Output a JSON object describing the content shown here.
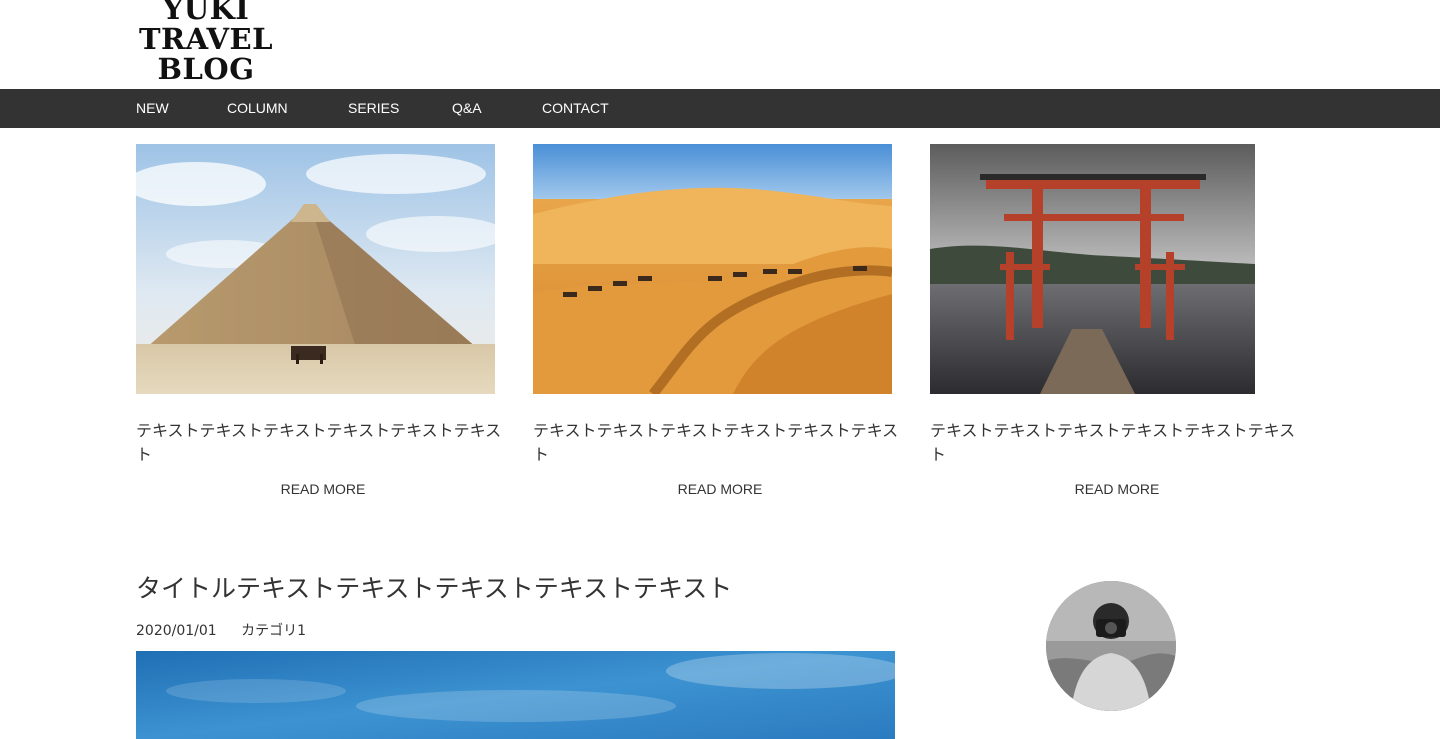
{
  "header": {
    "logo_line1": "YUKI",
    "logo_line2": "TRAVEL",
    "logo_line3": "BLOG"
  },
  "nav": {
    "items": [
      {
        "label": "NEW"
      },
      {
        "label": "COLUMN"
      },
      {
        "label": "SERIES"
      },
      {
        "label": "Q&A"
      },
      {
        "label": "CONTACT"
      }
    ]
  },
  "cards": [
    {
      "image": "pyramid-photo",
      "text": "テキストテキストテキストテキストテキストテキスト",
      "more": "READ MORE"
    },
    {
      "image": "desert-camels-photo",
      "text": "テキストテキストテキストテキストテキストテキスト",
      "more": "READ MORE"
    },
    {
      "image": "torii-gate-photo",
      "text": "テキストテキストテキストテキストテキストテキスト",
      "more": "READ MORE"
    }
  ],
  "post": {
    "title": "タイトルテキストテキストテキストテキストテキスト",
    "date": "2020/01/01",
    "category": "カテゴリ1",
    "image": "blue-sky-photo"
  },
  "profile": {
    "avatar": "photographer-avatar"
  },
  "colors": {
    "nav_bg": "#333333",
    "nav_text": "#ffffff",
    "body_text": "#333333"
  }
}
